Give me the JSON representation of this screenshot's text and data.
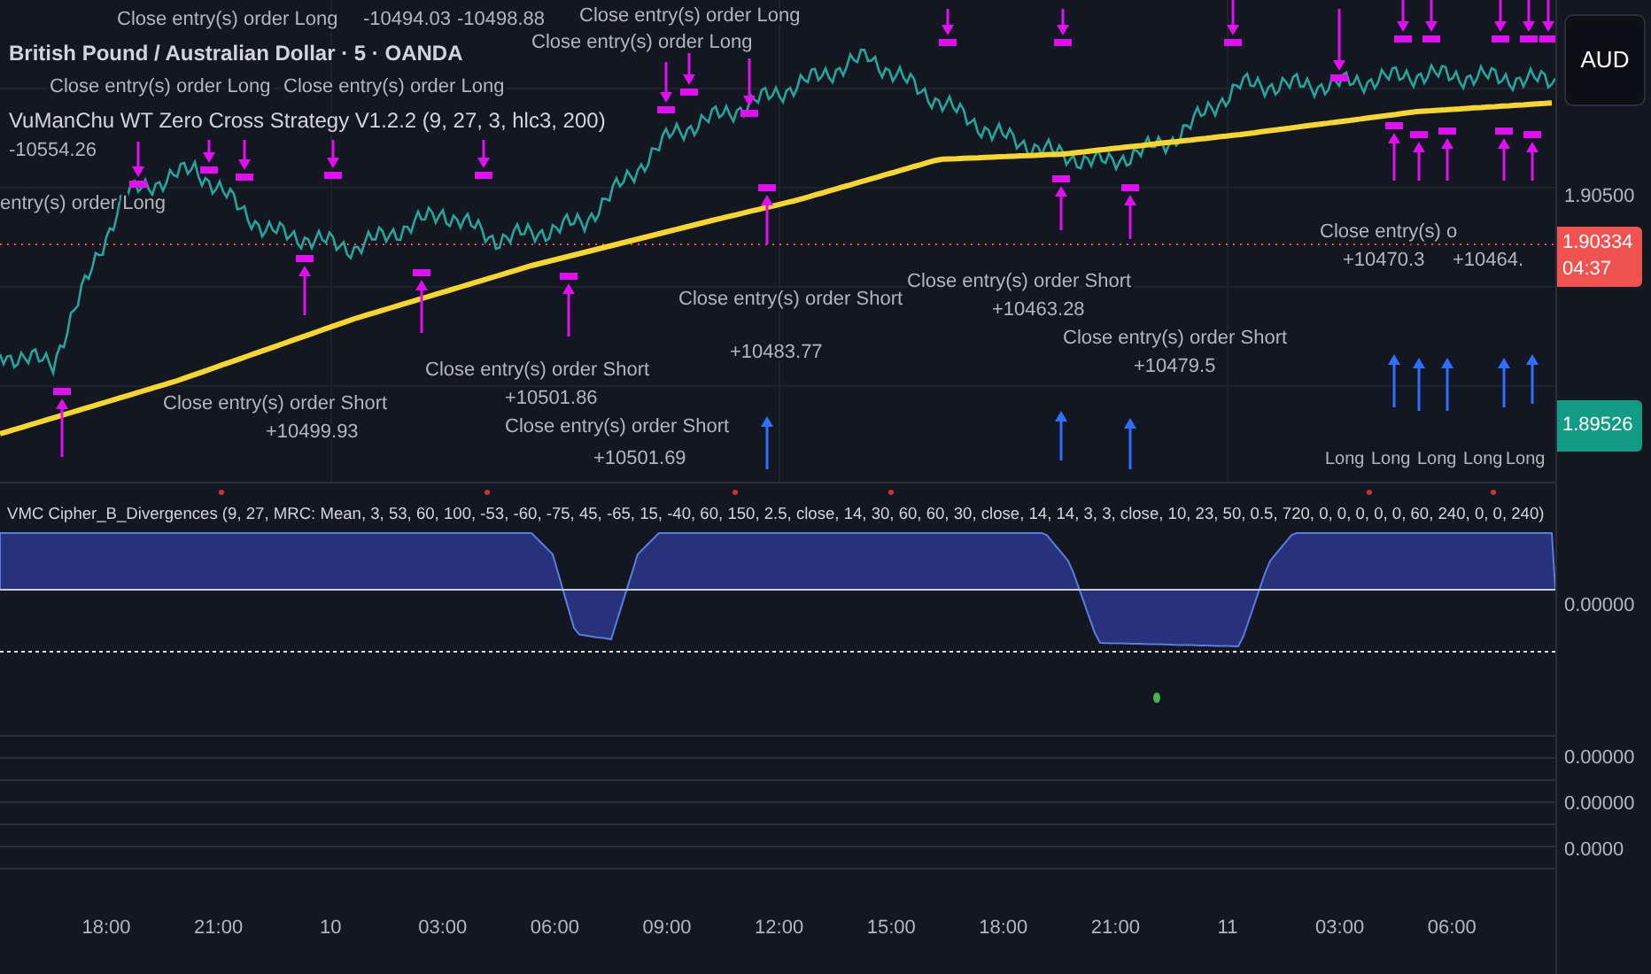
{
  "symbol_title": "British Pound / Australian Dollar · 5 · OANDA",
  "strategy_title": "VuManChu WT Zero Cross Strategy V1.2.2 (9, 27, 3, hlc3, 200)",
  "trade_labels": [
    "Close entry(s) order Long",
    "-10494.03",
    "-10498.88",
    "Close entry(s) order Long",
    "Close entry(s) order Long",
    "Close entry(s) order Long",
    "Close entry(s) order Long",
    "-10554.26",
    "entry(s) order Long",
    "Close entry(s) order Short",
    "+10483.77",
    "Close entry(s) order Short",
    "+10499.93",
    "Close entry(s) order Short",
    "+10501.86",
    "Close entry(s) order Short",
    "+10501.69",
    "Close entry(s) order Short",
    "+10463.28",
    "Close entry(s) order Short",
    "+10479.5",
    "Close entry(s) o",
    "+10470.3",
    "+10464."
  ],
  "signal_labels": [
    "Long",
    "Long",
    "Long",
    "Long",
    "Long"
  ],
  "price_axis": {
    "currency": "AUD",
    "tick": "1.90500",
    "last_price": "1.90334",
    "countdown": "04:37",
    "marker_price": "1.89526"
  },
  "indicator": {
    "title": "VMC Cipher_B_Divergences (9, 27, MRC: Mean, 3, 53, 60, 100, -53, -60, -75, 45, -65, 15, -40, 60, 150, 2.5, close, 14, 30, 60, 60, 30, close, 14, 14, 3, 3, close, 10, 23, 50, 0.5, 720, 0, 0, 0, 0, 0, 60, 240, 0, 0, 240)",
    "axis_value": "0.00000"
  },
  "sub_panels": [
    "0.00000",
    "0.00000",
    "0.0000"
  ],
  "time_axis": [
    "18:00",
    "21:00",
    "10",
    "03:00",
    "06:00",
    "09:00",
    "12:00",
    "15:00",
    "18:00",
    "21:00",
    "11",
    "03:00",
    "06:00"
  ]
}
